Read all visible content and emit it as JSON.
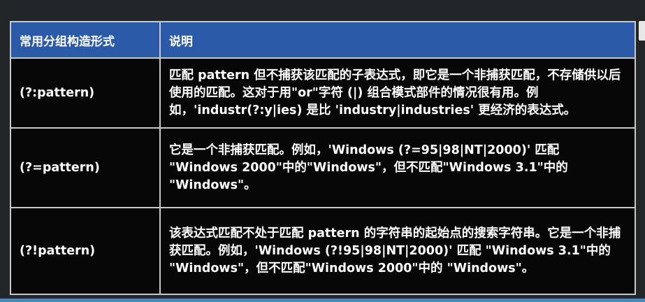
{
  "table": {
    "headers": [
      "常用分组构造形式",
      "说明"
    ],
    "rows": [
      {
        "syntax": "(?:pattern)",
        "description": "匹配 pattern 但不捕获该匹配的子表达式，即它是一个非捕获匹配，不存储供以后使用的匹配。这对于用\"or\"字符 (|) 组合模式部件的情况很有用。例如，'industr(?:y|ies) 是比 'industry|industries' 更经济的表达式。"
      },
      {
        "syntax": "(?=pattern)",
        "description": "它是一个非捕获匹配。例如，'Windows (?=95|98|NT|2000)' 匹配 \"Windows 2000\"中的\"Windows\"，但不匹配\"Windows 3.1\"中的 \"Windows\"。"
      },
      {
        "syntax": "(?!pattern)",
        "description": "该表达式匹配不处于匹配 pattern 的字符串的起始点的搜索字符串。它是一个非捕获匹配。例如，'Windows (?!95|98|NT|2000)' 匹配 \"Windows 3.1\"中的 \"Windows\"，但不匹配\"Windows 2000\"中的 \"Windows\"。"
      }
    ]
  },
  "colors": {
    "header_bg": "#2a5aa8",
    "cell_bg": "#070707",
    "border": "#c9c9c9",
    "page_bg": "#222629"
  }
}
